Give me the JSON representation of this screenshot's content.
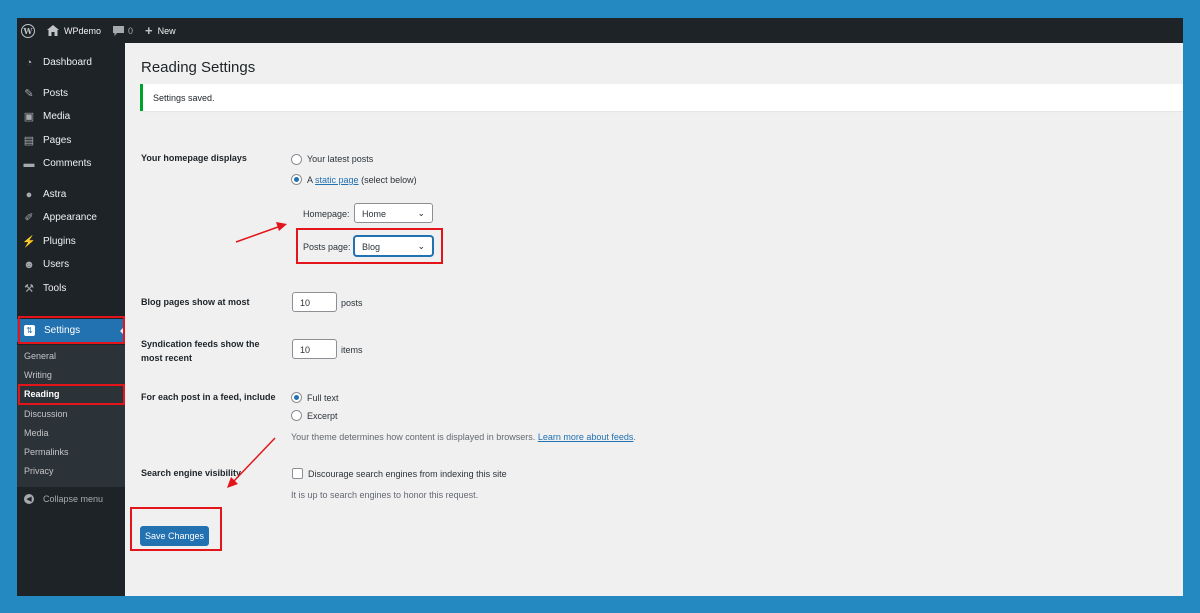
{
  "adminbar": {
    "wp_logo": "W",
    "site_name": "WPdemo",
    "comments_count": "0",
    "new_label": "New"
  },
  "sidebar": {
    "items": [
      {
        "label": "Dashboard",
        "icon": "dashboard-icon"
      },
      {
        "label": "Posts",
        "icon": "pin-icon"
      },
      {
        "label": "Media",
        "icon": "media-icon"
      },
      {
        "label": "Pages",
        "icon": "pages-icon"
      },
      {
        "label": "Comments",
        "icon": "comment-icon"
      },
      {
        "label": "Astra",
        "icon": "astra-icon"
      },
      {
        "label": "Appearance",
        "icon": "brush-icon"
      },
      {
        "label": "Plugins",
        "icon": "plugin-icon"
      },
      {
        "label": "Users",
        "icon": "users-icon"
      },
      {
        "label": "Tools",
        "icon": "wrench-icon"
      },
      {
        "label": "Settings",
        "icon": "settings-icon"
      }
    ],
    "submenu": [
      "General",
      "Writing",
      "Reading",
      "Discussion",
      "Media",
      "Permalinks",
      "Privacy"
    ],
    "collapse_label": "Collapse menu"
  },
  "page": {
    "title": "Reading Settings",
    "notice": "Settings saved.",
    "homepage_displays": {
      "label": "Your homepage displays",
      "option_latest": "Your latest posts",
      "option_static_prefix": "A",
      "option_static_link": "static page",
      "option_static_suffix": "(select below)",
      "homepage_label": "Homepage:",
      "homepage_value": "Home",
      "posts_page_label": "Posts page:",
      "posts_page_value": "Blog"
    },
    "blog_pages": {
      "label": "Blog pages show at most",
      "value": "10",
      "unit": "posts"
    },
    "syndication": {
      "label": "Syndication feeds show the most recent",
      "value": "10",
      "unit": "items"
    },
    "feed_include": {
      "label": "For each post in a feed, include",
      "option_full": "Full text",
      "option_excerpt": "Excerpt",
      "desc_prefix": "Your theme determines how content is displayed in browsers.",
      "desc_link": "Learn more about feeds",
      "desc_suffix": "."
    },
    "search_visibility": {
      "label": "Search engine visibility",
      "checkbox_label": "Discourage search engines from indexing this site",
      "desc": "It is up to search engines to honor this request."
    },
    "save_button": "Save Changes"
  },
  "colors": {
    "frame_bg": "#2489c0",
    "admin_dark": "#1d2327",
    "accent": "#2271b1",
    "success": "#00a32a",
    "annotation": "#e3151b"
  }
}
